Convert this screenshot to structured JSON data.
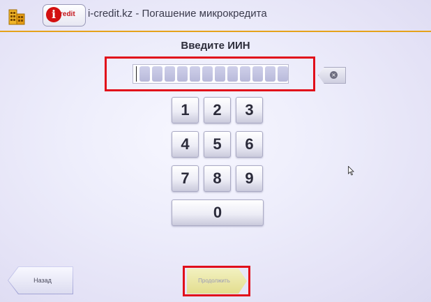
{
  "header": {
    "app_icon": "building-icon",
    "logo_letter": "i",
    "logo_text": "redit",
    "title": "i-credit.kz - Погашение микрокредита",
    "accent_color": "#e5a21a"
  },
  "prompt": "Введите ИИН",
  "iin_input": {
    "value": "",
    "cells": 12,
    "highlight_color": "#e10f1a"
  },
  "backspace": {
    "icon": "clear-icon"
  },
  "keypad": {
    "keys": [
      "1",
      "2",
      "3",
      "4",
      "5",
      "6",
      "7",
      "8",
      "9",
      "0"
    ]
  },
  "footer": {
    "back_label": "Назад",
    "next_label": "Продолжить"
  }
}
